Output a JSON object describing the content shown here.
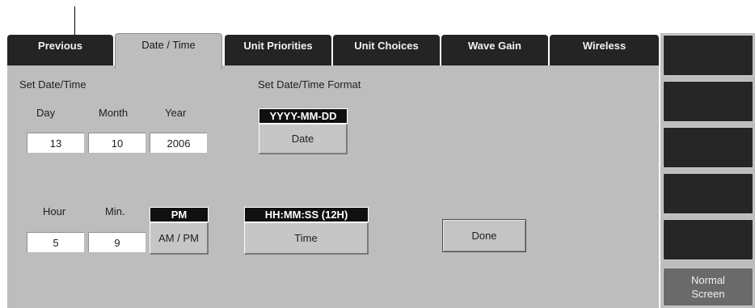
{
  "tabs": [
    {
      "label": "Previous",
      "active": false
    },
    {
      "label": "Date / Time",
      "active": true
    },
    {
      "label": "Unit Priorities",
      "active": false
    },
    {
      "label": "Unit Choices",
      "active": false
    },
    {
      "label": "Wave Gain",
      "active": false
    },
    {
      "label": "Wireless",
      "active": false
    }
  ],
  "date": {
    "section_title": "Set Date/Time",
    "day_label": "Day",
    "month_label": "Month",
    "year_label": "Year",
    "day_value": "13",
    "month_value": "10",
    "year_value": "2006"
  },
  "time": {
    "hour_label": "Hour",
    "min_label": "Min.",
    "hour_value": "5",
    "min_value": "9",
    "ampm_current": "PM",
    "ampm_button": "AM / PM"
  },
  "format": {
    "section_title": "Set Date/Time Format",
    "date_format": "YYYY-MM-DD",
    "date_button": "Date",
    "time_format": "HH:MM:SS (12H)",
    "time_button": "Time"
  },
  "done_button": "Done",
  "softkeys": {
    "normal_screen": "Normal\nScreen"
  },
  "colors": {
    "panel": "#bdbdbd",
    "tab_inactive": "#242424",
    "format_bar": "#101010",
    "softkey": "#262626"
  }
}
